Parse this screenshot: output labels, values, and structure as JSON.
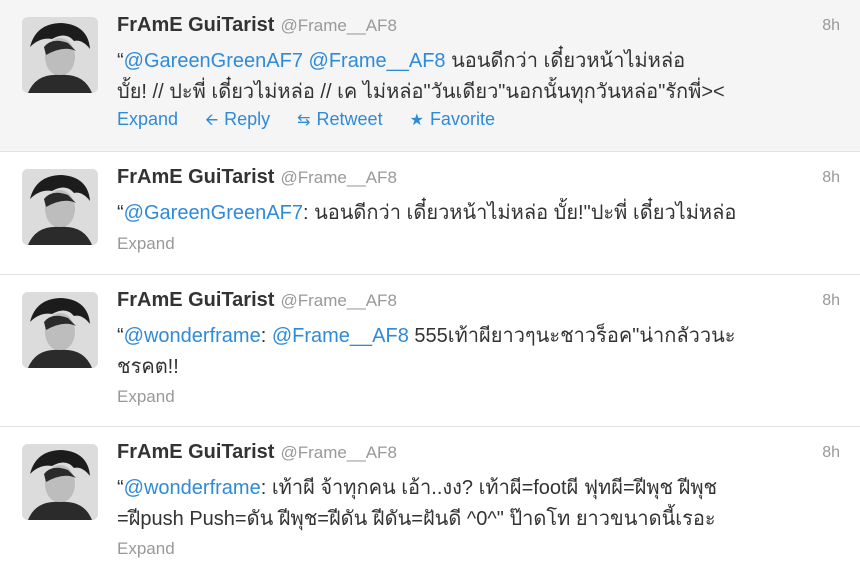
{
  "tweets": [
    {
      "fullname": "FrAmE GuiTarist",
      "username": "@Frame__AF8",
      "time": "8h",
      "line1": {
        "quote": "“",
        "m1": "@GareenGreenAF7",
        "sp": " ",
        "m2": "@Frame__AF8",
        "rest": " นอนดีกว่า เดี๋ยวหน้าไม่หล่อ"
      },
      "line2": "บั้ย! // ปะพี่ เดี๋ยวไม่หล่อ // เค ไม่หล่อ\"วันเดียว\"นอกนั้นทุกวันหล่อ\"รักพี่><",
      "actions": {
        "expand": "Expand",
        "reply": "Reply",
        "retweet": "Retweet",
        "favorite": "Favorite"
      }
    },
    {
      "fullname": "FrAmE GuiTarist",
      "username": "@Frame__AF8",
      "time": "8h",
      "line1": {
        "quote": "“",
        "m1": "@GareenGreenAF7",
        "rest": ": นอนดีกว่า เดี๋ยวหน้าไม่หล่อ บั้ย!\"ปะพี่ เดี๋ยวไม่หล่อ"
      },
      "expand": "Expand"
    },
    {
      "fullname": "FrAmE GuiTarist",
      "username": "@Frame__AF8",
      "time": "8h",
      "line1": {
        "quote": "“",
        "m1": "@wonderframe",
        "sep": ": ",
        "m2": "@Frame__AF8",
        "rest": " 555เท้าผียาวๆนะชาวร็อค\"น่ากลัววนะ"
      },
      "line2": "ชรคต!!",
      "expand": "Expand"
    },
    {
      "fullname": "FrAmE GuiTarist",
      "username": "@Frame__AF8",
      "time": "8h",
      "line1": {
        "quote": "“",
        "m1": "@wonderframe",
        "rest": ": เท้าผี จ้าทุกคน เอ้า..งง? เท้าผี=footผี ฟุทผี=ฝีพุช ฝีพุช"
      },
      "line2": "=ฝีpush Push=ดัน ฝีพุช=ฝีดัน ฝีดัน=ฝันดี ^0^\" ป๊าดโท ยาวขนาดนี้เรอะ",
      "expand": "Expand"
    }
  ],
  "colors": {
    "link": "#2f8ad8",
    "muted": "#999999",
    "text": "#333333",
    "highlight_bg": "#f5f5f5"
  },
  "icons": {
    "reply": "reply-arrow-icon",
    "retweet": "retweet-icon",
    "favorite": "star-icon"
  }
}
